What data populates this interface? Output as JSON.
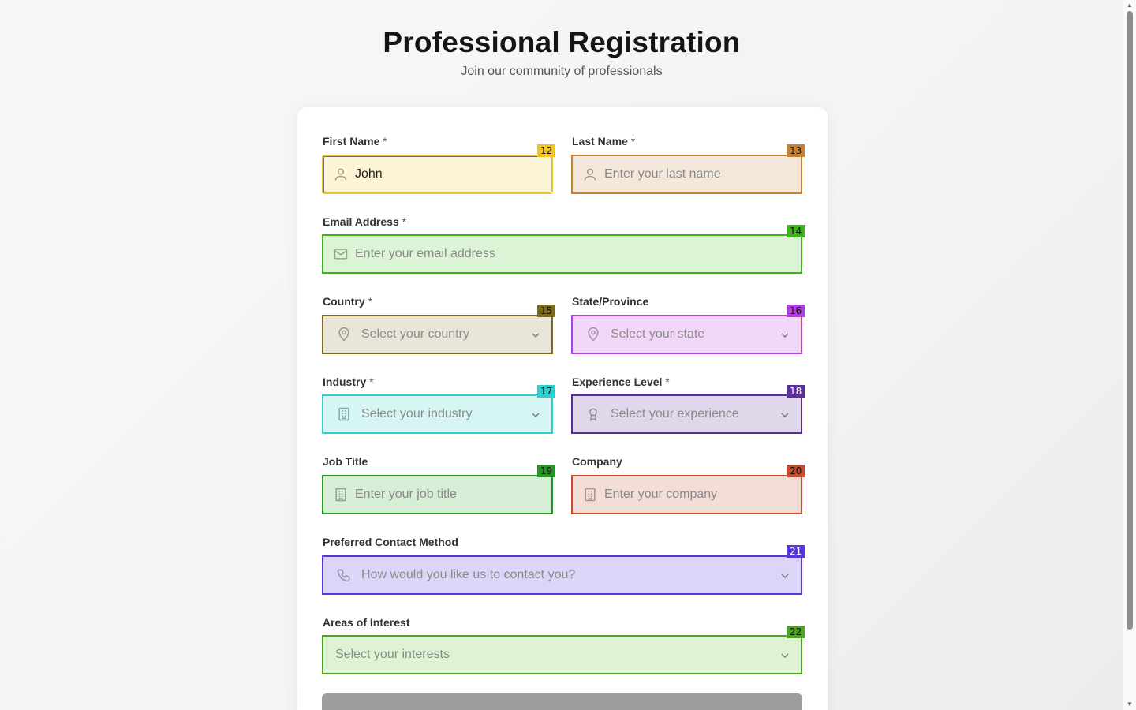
{
  "header": {
    "title": "Professional Registration",
    "subtitle": "Join our community of professionals"
  },
  "fields": {
    "first_name": {
      "label": "First Name",
      "required_mark": "*",
      "value": "John",
      "badge": "12",
      "icon": "user-icon"
    },
    "last_name": {
      "label": "Last Name",
      "required_mark": "*",
      "placeholder": "Enter your last name",
      "badge": "13",
      "icon": "user-icon"
    },
    "email": {
      "label": "Email Address",
      "required_mark": "*",
      "placeholder": "Enter your email address",
      "badge": "14",
      "icon": "mail-icon"
    },
    "country": {
      "label": "Country",
      "required_mark": "*",
      "placeholder": "Select your country",
      "badge": "15",
      "icon": "map-pin-icon"
    },
    "state": {
      "label": "State/Province",
      "placeholder": "Select your state",
      "badge": "16",
      "icon": "map-pin-icon"
    },
    "industry": {
      "label": "Industry",
      "required_mark": "*",
      "placeholder": "Select your industry",
      "badge": "17",
      "icon": "building-icon"
    },
    "experience": {
      "label": "Experience Level",
      "required_mark": "*",
      "placeholder": "Select your experience",
      "badge": "18",
      "icon": "award-icon"
    },
    "job_title": {
      "label": "Job Title",
      "placeholder": "Enter your job title",
      "badge": "19",
      "icon": "building-icon"
    },
    "company": {
      "label": "Company",
      "placeholder": "Enter your company",
      "badge": "20",
      "icon": "building-icon"
    },
    "contact_method": {
      "label": "Preferred Contact Method",
      "placeholder": "How would you like us to contact you?",
      "badge": "21",
      "icon": "phone-icon"
    },
    "interests": {
      "label": "Areas of Interest",
      "placeholder": "Select your interests",
      "badge": "22"
    }
  },
  "colors": {
    "badge_12": "#f2c31b",
    "badge_13": "#c8812f",
    "badge_14": "#3cb51c",
    "badge_15": "#7d6a1c",
    "badge_16": "#b23ee0",
    "badge_17": "#2fcfcf",
    "badge_18": "#5b2d9a",
    "badge_19": "#1f9a1f",
    "badge_20": "#c94a2a",
    "badge_21": "#5a35e0",
    "badge_22": "#4aa51c"
  }
}
